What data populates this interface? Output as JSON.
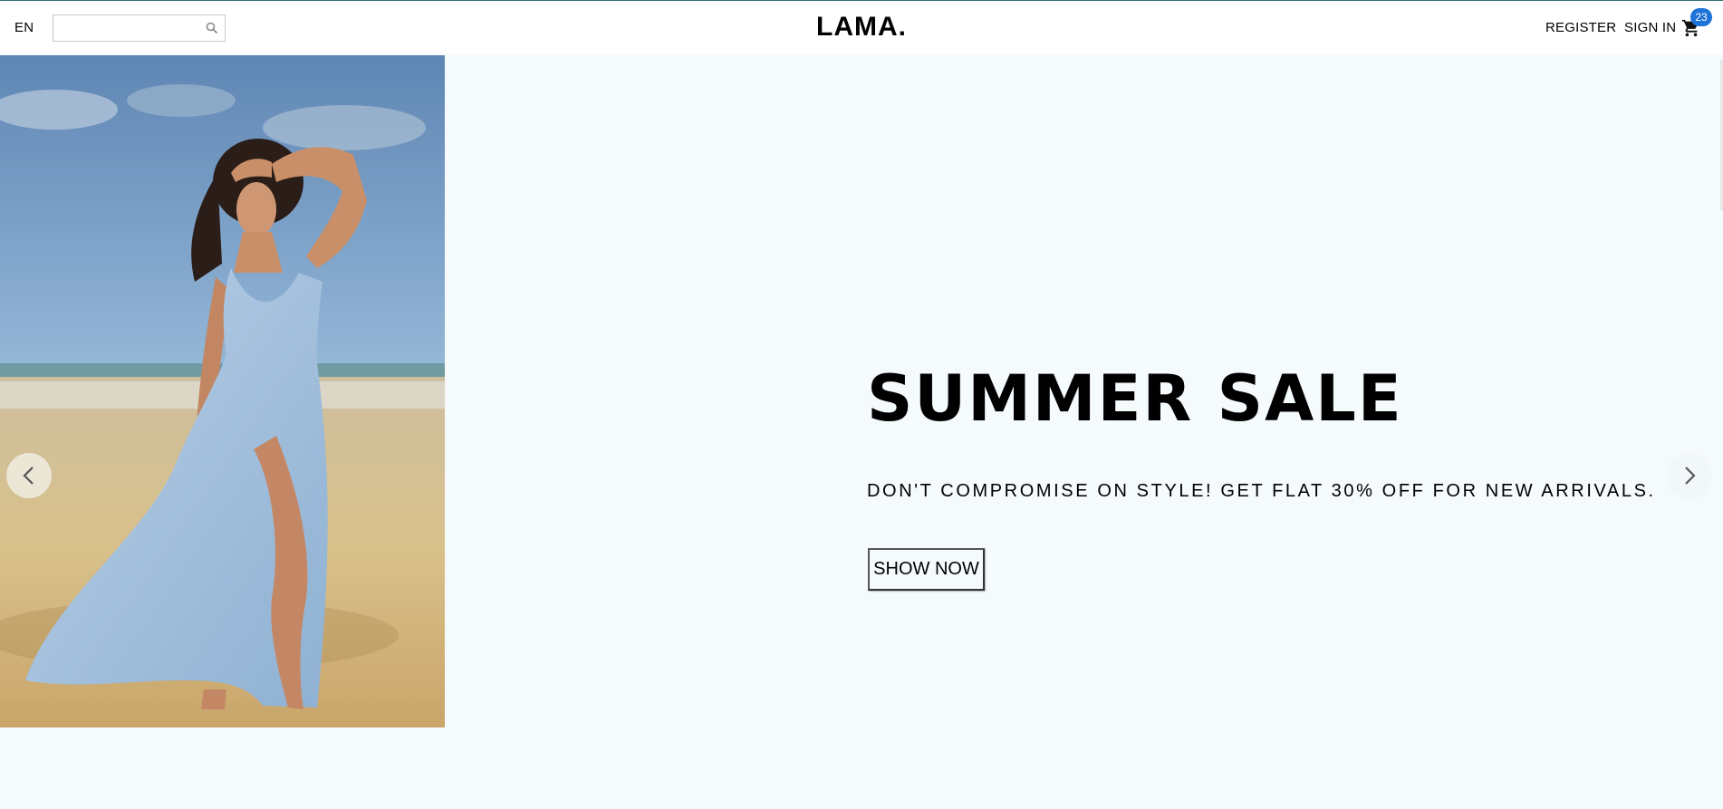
{
  "header": {
    "language": "EN",
    "search": {
      "value": "",
      "placeholder": "",
      "icon": "search-icon"
    },
    "logo": "LAMA.",
    "register_label": "REGISTER",
    "signin_label": "SIGN IN",
    "cart": {
      "icon": "shopping-cart-icon",
      "count": "23"
    }
  },
  "slide": {
    "title": "SUMMER SALE",
    "description": "DON'T COMPROMISE ON STYLE! GET FLAT 30% OFF FOR NEW ARRIVALS.",
    "button_label": "SHOW NOW",
    "image": "woman-in-blue-dress-on-beach-photo"
  },
  "slider": {
    "prev_icon": "chevron-left-icon",
    "next_icon": "chevron-right-icon"
  },
  "colors": {
    "background": "#f5fafd",
    "badge": "#1e73d8",
    "text": "#000000"
  }
}
